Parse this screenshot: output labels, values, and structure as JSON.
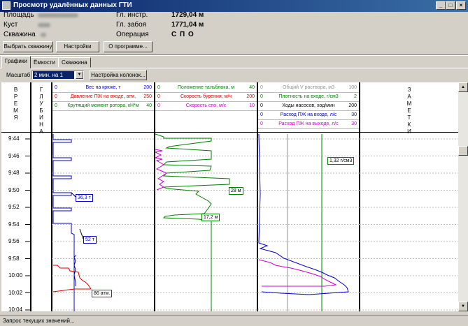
{
  "window": {
    "title": "Просмотр удалённых данных ГТИ",
    "minimize": "_",
    "maximize": "□",
    "close": "×"
  },
  "info": {
    "area_label": "Площадь",
    "bush_label": "Куст",
    "well_label": "Скважина",
    "tool_depth_label": "Гл. инстр.",
    "tool_depth_value": "1729,04 м",
    "bottom_depth_label": "Гл. забоя",
    "bottom_depth_value": "1771,04 м",
    "operation_label": "Операция",
    "operation_value": "С П О"
  },
  "toolbar": {
    "select_well": "Выбрать скважину",
    "settings": "Настройки",
    "about": "О программе..."
  },
  "tabs": [
    "Графики",
    "Ёмкости",
    "Скважина"
  ],
  "scale": {
    "label": "Масштаб",
    "value": "2 мин. на 1",
    "columns_button": "Настройка колонок..."
  },
  "columns": {
    "time_title": "В Р Е М Я",
    "depth_title": "Г Л У Б И Н А",
    "notes_title": "З А М Е Т К И",
    "track1": [
      {
        "name": "Вес на крюке, т",
        "lo": "0",
        "hi": "200",
        "color": "#0000cc"
      },
      {
        "name": "Давление ПЖ на входе, атм.",
        "lo": "0",
        "hi": "250",
        "color": "#dd0000"
      },
      {
        "name": "Крутящий момент ротора, кН*м",
        "lo": "0",
        "hi": "40",
        "color": "#008000"
      }
    ],
    "track2": [
      {
        "name": "Положение тальблока, м",
        "lo": "0",
        "hi": "40",
        "color": "#008000"
      },
      {
        "name": "Скорость бурения, м/ч",
        "lo": "0",
        "hi": "200",
        "color": "#dd0000"
      },
      {
        "name": "Скорость спо, м/с",
        "lo": "0",
        "hi": "10",
        "color": "#cc00cc"
      }
    ],
    "track3": [
      {
        "name": "Общий V раствора, м3",
        "lo": "0",
        "hi": "100",
        "color": "#909090"
      },
      {
        "name": "Плотность на входе, г/см3",
        "lo": "0",
        "hi": "2",
        "color": "#008000"
      },
      {
        "name": "Ходы насосов, ход/мин",
        "lo": "0",
        "hi": "200",
        "color": "#000000"
      },
      {
        "name": "Расход ПЖ на входе, л/с",
        "lo": "0",
        "hi": "30",
        "color": "#0000cc"
      },
      {
        "name": "Расход ПЖ на выходе, л/с",
        "lo": "0",
        "hi": "30",
        "color": "#cc00cc"
      }
    ]
  },
  "time_labels": [
    "9:44",
    "9:46",
    "9:48",
    "9:50",
    "9:52",
    "9:54",
    "9:56",
    "9:58",
    "10:00",
    "10:02",
    "10:04"
  ],
  "annotations": {
    "weight_1": "36,3 т",
    "weight_2": "52 т",
    "pressure": "86 атм.",
    "block_1": "28 м",
    "block_2": "17,2 м",
    "density": "1,32 г/см3"
  },
  "status": "Запрос текущих значений..."
}
